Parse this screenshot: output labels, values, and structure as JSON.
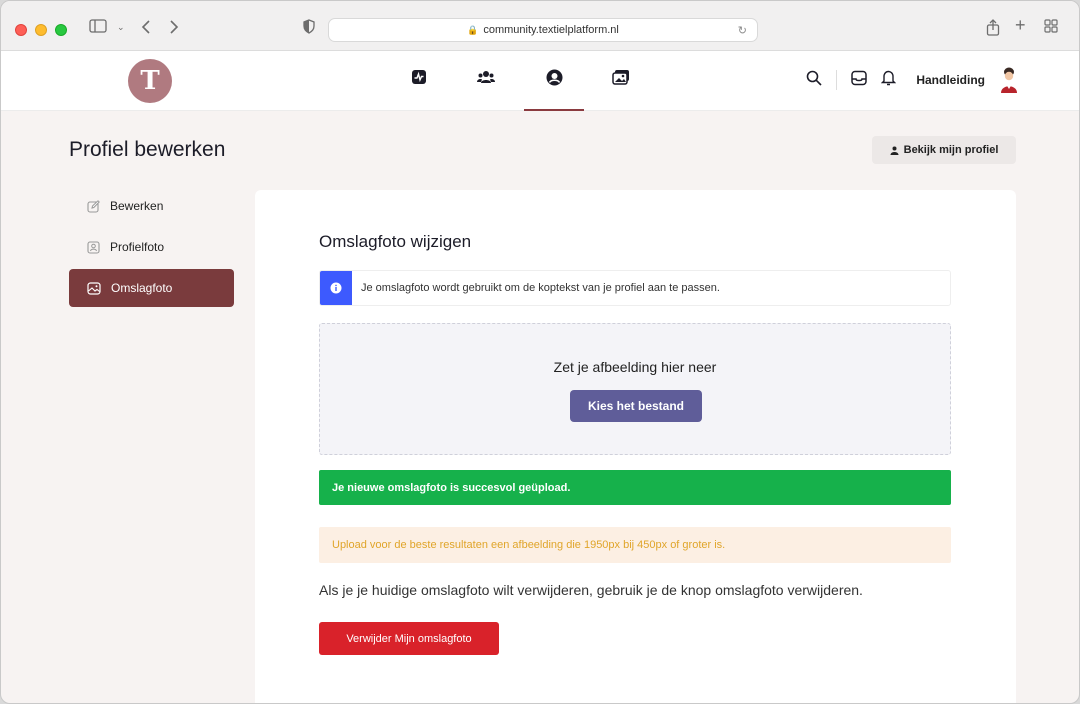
{
  "browser": {
    "url": "community.textielplatform.nl"
  },
  "header": {
    "logo_letter": "T",
    "user_name": "Handleiding"
  },
  "page": {
    "title": "Profiel bewerken",
    "view_profile_label": "Bekijk mijn profiel"
  },
  "sidebar": {
    "items": [
      {
        "label": "Bewerken",
        "icon": "edit-icon",
        "active": false
      },
      {
        "label": "Profielfoto",
        "icon": "profile-photo-icon",
        "active": false
      },
      {
        "label": "Omslagfoto",
        "icon": "cover-photo-icon",
        "active": true
      }
    ]
  },
  "main": {
    "title": "Omslagfoto wijzigen",
    "info_text": "Je omslagfoto wordt gebruikt om de koptekst van je profiel aan te passen.",
    "dropzone_text": "Zet je afbeelding hier neer",
    "choose_file_label": "Kies het bestand",
    "success_text": "Je nieuwe omslagfoto is succesvol geüpload.",
    "warning_text": "Upload voor de beste resultaten een afbeelding die 1950px bij 450px of groter is.",
    "remove_text": "Als je je huidige omslagfoto wilt verwijderen, gebruik je de knop omslagfoto verwijderen.",
    "remove_button_label": "Verwijder Mijn omslagfoto"
  },
  "colors": {
    "accent": "#7a3b3d",
    "info": "#3d5afe",
    "primary_button": "#5f5d99",
    "success": "#16b14b",
    "warning_bg": "#fcefe3",
    "warning_text": "#e0a52a",
    "danger": "#d9222a"
  }
}
